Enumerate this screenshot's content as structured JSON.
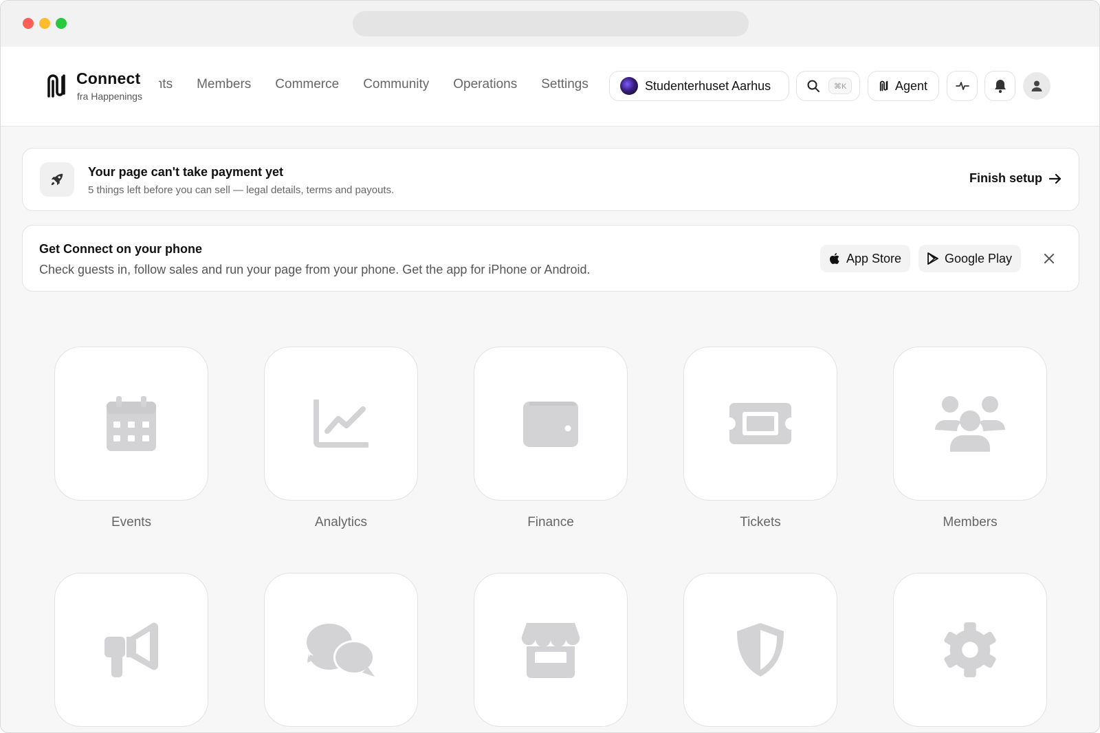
{
  "window": {},
  "brand": {
    "name": "Connect",
    "subtitle": "fra Happenings"
  },
  "nav": {
    "tabs": [
      {
        "label": "Events"
      },
      {
        "label": "Members"
      },
      {
        "label": "Commerce"
      },
      {
        "label": "Community"
      },
      {
        "label": "Operations"
      },
      {
        "label": "Settings"
      }
    ],
    "org_name": "Studenterhuset Aarhus",
    "search_shortcut": "⌘K",
    "agent_label": "Agent"
  },
  "setup_banner": {
    "title": "Your page can't take payment yet",
    "subtitle": "5 things left before you can sell — legal details, terms and payouts.",
    "action_label": "Finish setup"
  },
  "phone_banner": {
    "title": "Get Connect on your phone",
    "subtitle": "Check guests in, follow sales and run your page from your phone. Get the app for iPhone or Android.",
    "app_store_label": "App Store",
    "google_play_label": "Google Play"
  },
  "apps": [
    {
      "label": "Events",
      "icon": "calendar-icon"
    },
    {
      "label": "Analytics",
      "icon": "chart-line-icon"
    },
    {
      "label": "Finance",
      "icon": "wallet-icon"
    },
    {
      "label": "Tickets",
      "icon": "ticket-icon"
    },
    {
      "label": "Members",
      "icon": "users-icon"
    },
    {
      "label": "",
      "icon": "megaphone-icon"
    },
    {
      "label": "",
      "icon": "chat-bubbles-icon"
    },
    {
      "label": "",
      "icon": "store-icon"
    },
    {
      "label": "",
      "icon": "shield-icon"
    },
    {
      "label": "",
      "icon": "gear-icon"
    }
  ],
  "colors": {
    "icon_gray": "#d3d3d5",
    "text_dark": "#111111",
    "text_muted": "#666666"
  }
}
